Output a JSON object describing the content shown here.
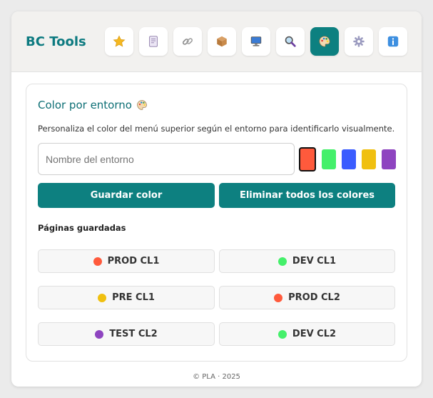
{
  "header": {
    "brand": "BC Tools",
    "tools": [
      {
        "icon": "star-icon",
        "active": false
      },
      {
        "icon": "notes-icon",
        "active": false
      },
      {
        "icon": "link-icon",
        "active": false
      },
      {
        "icon": "package-icon",
        "active": false
      },
      {
        "icon": "computer-icon",
        "active": false
      },
      {
        "icon": "magnifier-icon",
        "active": false
      },
      {
        "icon": "palette-icon",
        "active": true
      },
      {
        "icon": "gear-icon",
        "active": false
      },
      {
        "icon": "info-icon",
        "active": false
      }
    ]
  },
  "panel": {
    "title": "Color por entorno",
    "description": "Personaliza el color del menú superior según el entorno para identificarlo visualmente.",
    "input_placeholder": "Nombre del entorno",
    "input_value": "",
    "swatches": [
      "#ff5a3c",
      "#44f06a",
      "#3a5cff",
      "#f0c010",
      "#8e44c0"
    ],
    "selected_swatch": 0,
    "save_label": "Guardar color",
    "clear_label": "Eliminar todos los colores",
    "saved_heading": "Páginas guardadas",
    "saved": [
      {
        "label": "PROD CL1",
        "color": "#ff5a3c"
      },
      {
        "label": "DEV CL1",
        "color": "#44f06a"
      },
      {
        "label": "PRE CL1",
        "color": "#f0c010"
      },
      {
        "label": "PROD CL2",
        "color": "#ff5a3c"
      },
      {
        "label": "TEST CL2",
        "color": "#8e44c0"
      },
      {
        "label": "DEV CL2",
        "color": "#44f06a"
      }
    ]
  },
  "footer": "© PLA · 2025",
  "colors": {
    "accent": "#0d8080",
    "brand": "#0d7a80"
  }
}
